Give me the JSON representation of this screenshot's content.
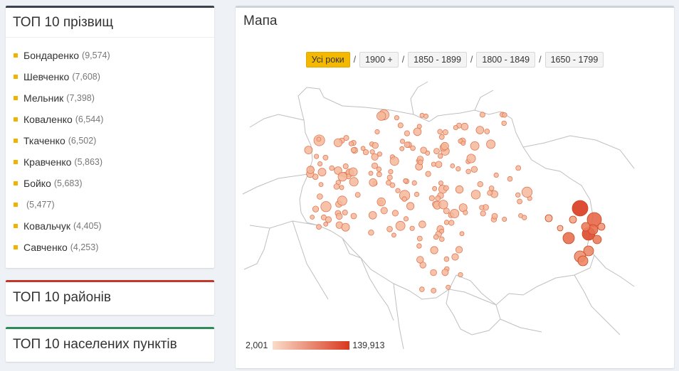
{
  "surnames": {
    "title": "ТОП 10 прізвищ",
    "items": [
      {
        "name": "Бондаренко",
        "count": "(9,574)"
      },
      {
        "name": "Шевченко",
        "count": "(7,608)"
      },
      {
        "name": "Мельник",
        "count": "(7,398)"
      },
      {
        "name": "Коваленко",
        "count": "(6,544)"
      },
      {
        "name": "Ткаченко",
        "count": "(6,502)"
      },
      {
        "name": "Кравченко",
        "count": "(5,863)"
      },
      {
        "name": "Бойко",
        "count": "(5,683)"
      },
      {
        "name": "",
        "count": "(5,477)"
      },
      {
        "name": "Ковальчук",
        "count": "(4,405)"
      },
      {
        "name": "Савченко",
        "count": "(4,253)"
      }
    ]
  },
  "districts": {
    "title": "ТОП 10 районів"
  },
  "settlements": {
    "title": "ТОП 10 населених пунктів"
  },
  "map": {
    "title": "Мапа",
    "filters": [
      "Усі роки",
      "1900 +",
      "1850 - 1899",
      "1800 - 1849",
      "1650 - 1799"
    ],
    "active_filter": "Усі роки",
    "legend_min": "2,001",
    "legend_max": "139,913",
    "colors": {
      "low": "#f9ddc9",
      "high": "#d9381e",
      "accent": "#f5b800"
    }
  }
}
